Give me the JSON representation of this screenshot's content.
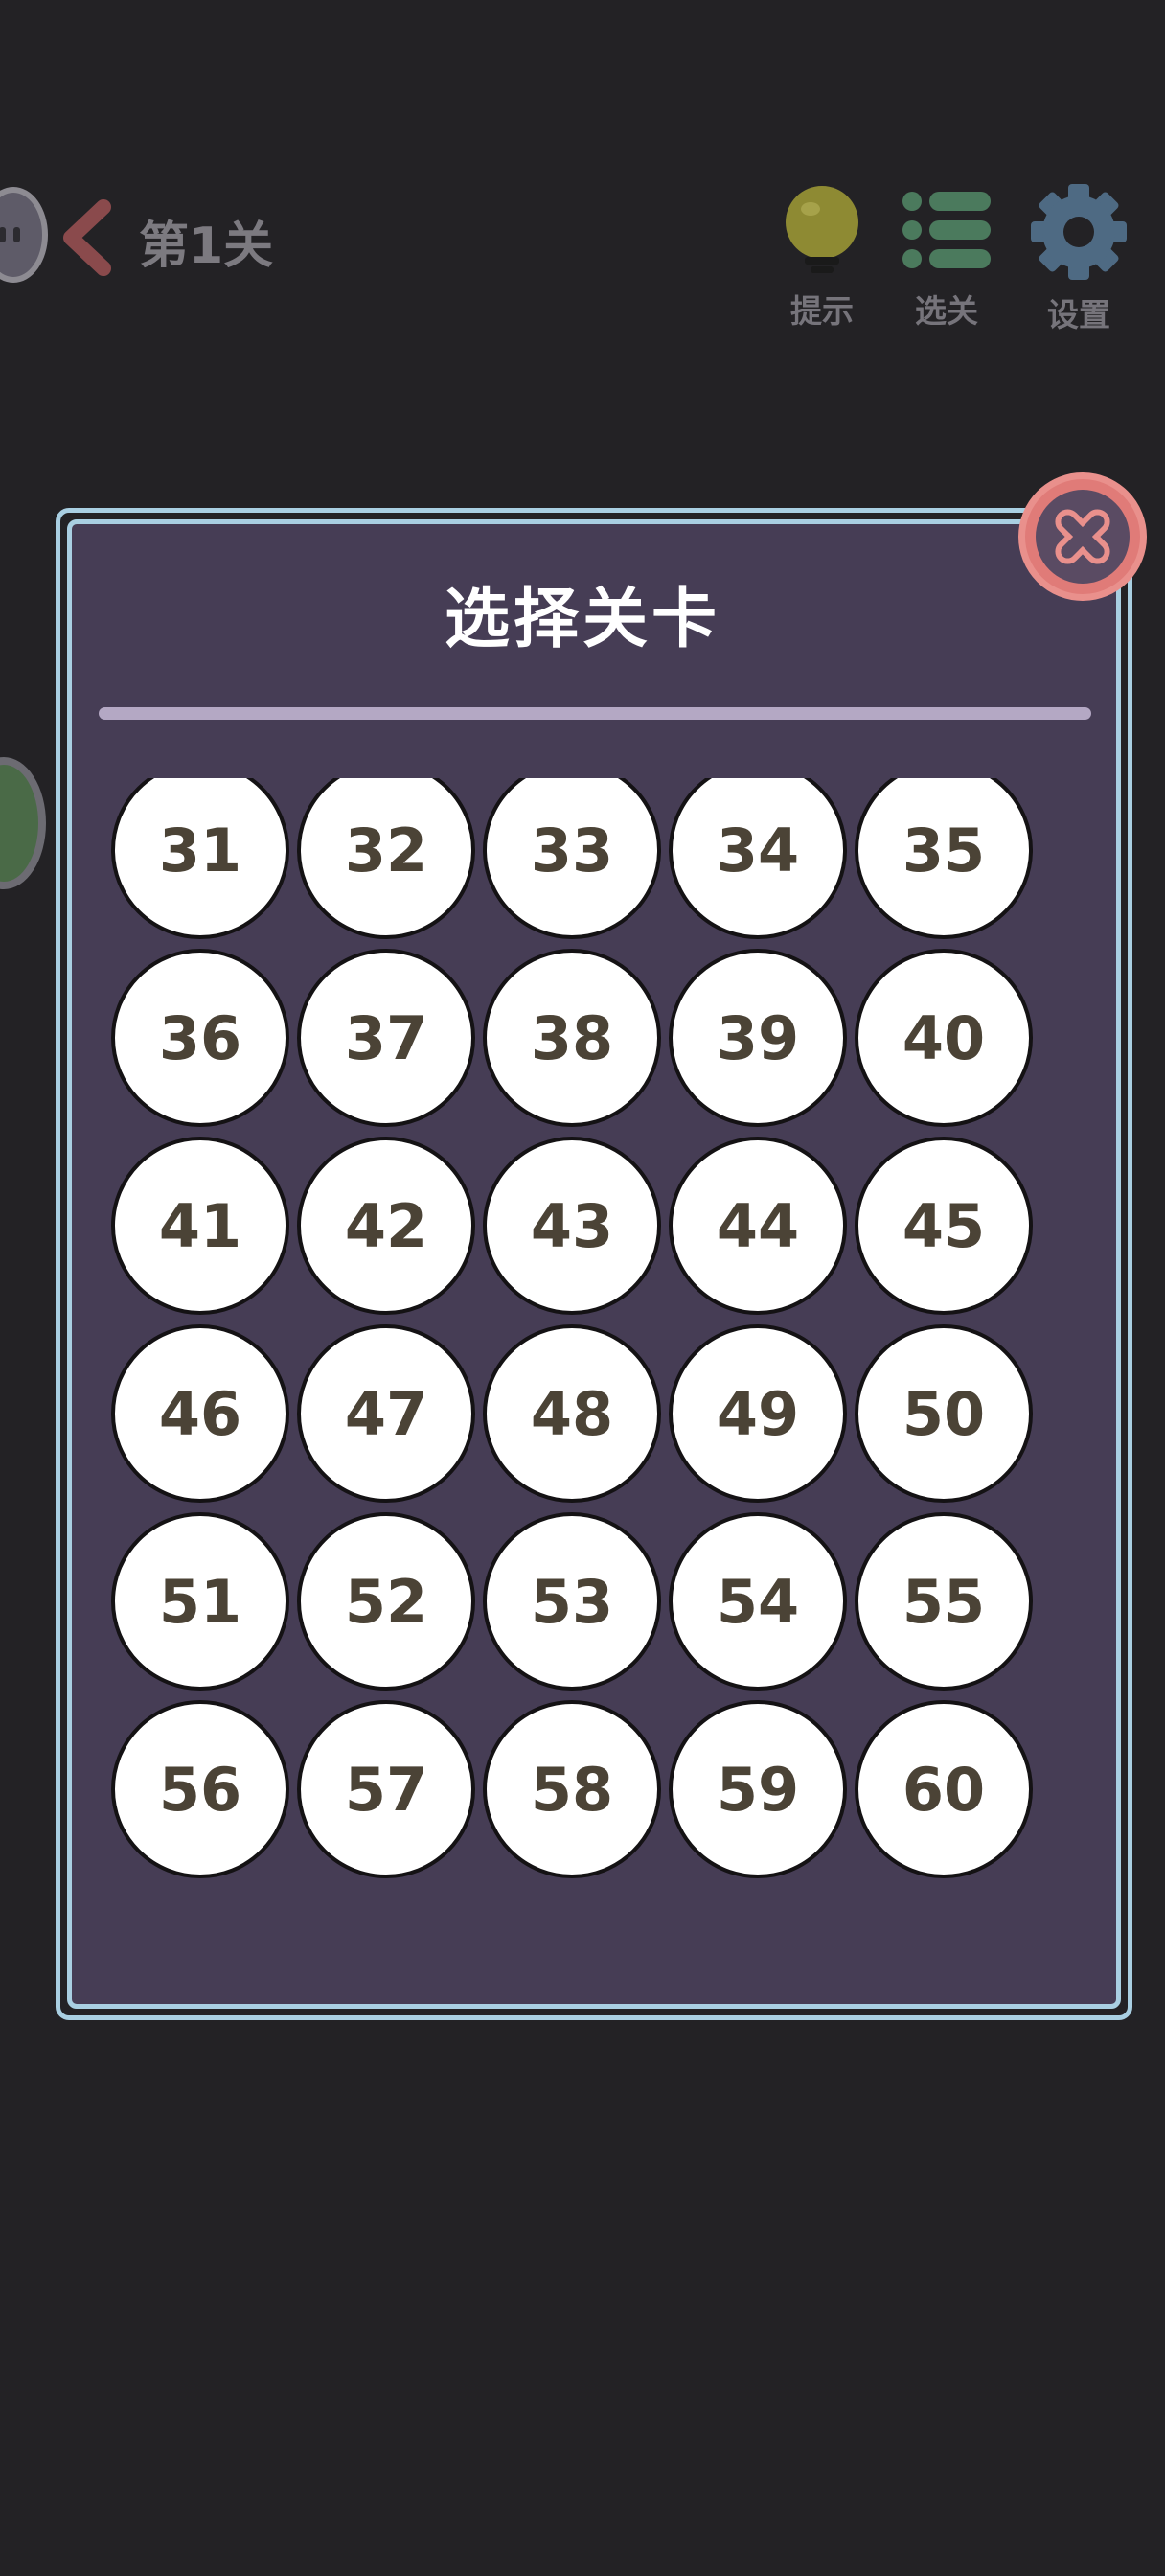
{
  "hud": {
    "level_title": "第1关",
    "buttons": [
      {
        "name": "hint",
        "label": "提示",
        "icon": "lightbulb-icon",
        "color": "#8e8a33"
      },
      {
        "name": "select-level",
        "label": "选关",
        "icon": "list-icon",
        "color": "#4b7a5d"
      },
      {
        "name": "settings",
        "label": "设置",
        "icon": "gear-icon",
        "color": "#4e6a83"
      }
    ]
  },
  "dialog": {
    "title": "选择关卡",
    "close_icon": "close-icon",
    "levels": [
      31,
      32,
      33,
      34,
      35,
      36,
      37,
      38,
      39,
      40,
      41,
      42,
      43,
      44,
      45,
      46,
      47,
      48,
      49,
      50,
      51,
      52,
      53,
      54,
      55,
      56,
      57,
      58,
      59,
      60
    ]
  },
  "colors": {
    "background": "#232225",
    "dialog_fill": "#463d55",
    "dialog_border": "#a9cfe2",
    "close_button": "#e07b78",
    "level_text": "#4b4336"
  }
}
